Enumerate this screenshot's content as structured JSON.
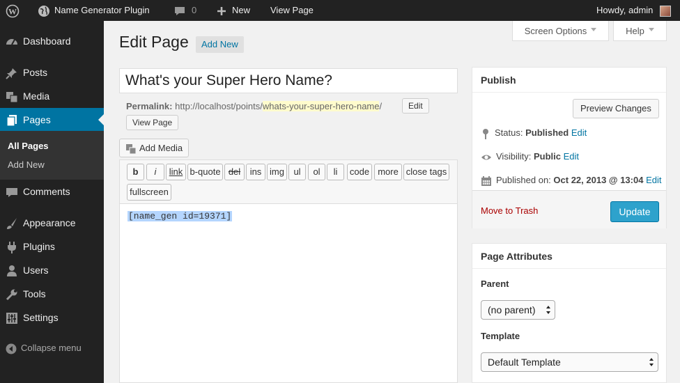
{
  "adminbar": {
    "site_name": "Name Generator Plugin",
    "comments_count": "0",
    "new_label": "New",
    "view_page": "View Page",
    "howdy": "Howdy, admin"
  },
  "menu": {
    "items": [
      {
        "label": "Dashboard",
        "icon": "dashboard-icon"
      },
      {
        "label": "Posts",
        "icon": "pin-icon"
      },
      {
        "label": "Media",
        "icon": "media-icon"
      },
      {
        "label": "Pages",
        "icon": "pages-icon"
      },
      {
        "label": "Comments",
        "icon": "comment-icon"
      },
      {
        "label": "Appearance",
        "icon": "brush-icon"
      },
      {
        "label": "Plugins",
        "icon": "plug-icon"
      },
      {
        "label": "Users",
        "icon": "user-icon"
      },
      {
        "label": "Tools",
        "icon": "wrench-icon"
      },
      {
        "label": "Settings",
        "icon": "settings-icon"
      }
    ],
    "submenu": [
      "All Pages",
      "Add New"
    ],
    "collapse": "Collapse menu"
  },
  "screen_options": "Screen Options",
  "help": "Help",
  "page_title": "Edit Page",
  "add_new": "Add New",
  "post_title": "What's your Super Hero Name?",
  "permalink": {
    "label": "Permalink:",
    "base": "http://localhost/points/",
    "slug": "whats-your-super-hero-name",
    "trailing": "/",
    "edit": "Edit",
    "view_page": "View Page"
  },
  "add_media": "Add Media",
  "quicktags": [
    "b",
    "i",
    "link",
    "b-quote",
    "del",
    "ins",
    "img",
    "ul",
    "ol",
    "li",
    "code",
    "more",
    "close tags",
    "fullscreen"
  ],
  "editor_content": "[name_gen id=19371]",
  "publish": {
    "title": "Publish",
    "preview": "Preview Changes",
    "status_label": "Status:",
    "status_value": "Published",
    "visibility_label": "Visibility:",
    "visibility_value": "Public",
    "published_label": "Published on:",
    "published_value": "Oct 22, 2013 @ 13:04",
    "edit": "Edit",
    "trash": "Move to Trash",
    "update": "Update"
  },
  "attributes": {
    "title": "Page Attributes",
    "parent_label": "Parent",
    "parent_value": "(no parent)",
    "template_label": "Template",
    "template_value": "Default Template"
  }
}
